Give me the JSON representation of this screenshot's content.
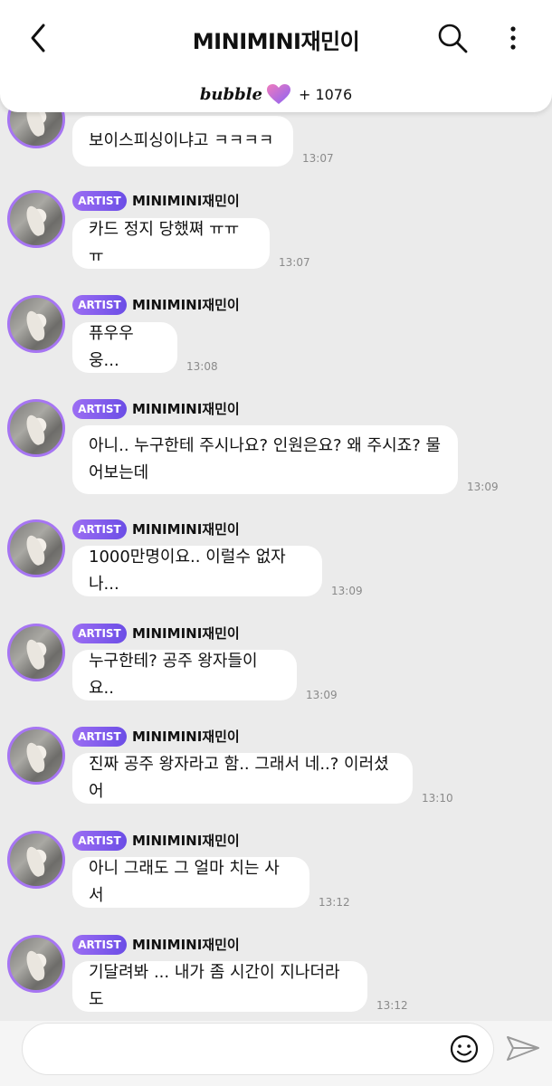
{
  "header": {
    "title": "MINIMINI재민이",
    "brand": "bubble",
    "letter_count": "+ 1076"
  },
  "messages": [
    {
      "text_lines": [
        "보이스피싱이냐고 ㅋㅋㅋㅋ"
      ],
      "time": "13:07",
      "show_header": false
    },
    {
      "badge": "ARTIST",
      "name": "MINIMINI재민이",
      "text_lines": [
        "카드 정지 당했쪄 ㅠㅠㅠ"
      ],
      "time": "13:07"
    },
    {
      "badge": "ARTIST",
      "name": "MINIMINI재민이",
      "text_lines": [
        "퓨우우웅..."
      ],
      "time": "13:08"
    },
    {
      "badge": "ARTIST",
      "name": "MINIMINI재민이",
      "text_lines": [
        "아니.. 누구한테 주시나요? 인원은요? 왜 주시죠? 물",
        "어보는데"
      ],
      "time": "13:09"
    },
    {
      "badge": "ARTIST",
      "name": "MINIMINI재민이",
      "text_lines": [
        "1000만명이요.. 이럴수 없자나..."
      ],
      "time": "13:09"
    },
    {
      "badge": "ARTIST",
      "name": "MINIMINI재민이",
      "text_lines": [
        "누구한테? 공주 왕자들이요.."
      ],
      "time": "13:09"
    },
    {
      "badge": "ARTIST",
      "name": "MINIMINI재민이",
      "text_lines": [
        "진짜 공주 왕자라고 함.. 그래서 네..? 이러셨어"
      ],
      "time": "13:10"
    },
    {
      "badge": "ARTIST",
      "name": "MINIMINI재민이",
      "text_lines": [
        "아니 그래도 그 얼마 치는 사서"
      ],
      "time": "13:12"
    },
    {
      "badge": "ARTIST",
      "name": "MINIMINI재민이",
      "text_lines": [
        "기달려봐 ... 내가 좀 시간이 지나더라도"
      ],
      "time": "13:12"
    }
  ],
  "icons": {
    "back": "chevron-left-icon",
    "search": "search-icon",
    "more": "more-vertical-icon",
    "heart": "heart-icon",
    "emoji": "smiley-icon",
    "send": "paper-plane-icon"
  },
  "colors": {
    "accent": "#8b5cf6",
    "background": "#ebebeb"
  }
}
